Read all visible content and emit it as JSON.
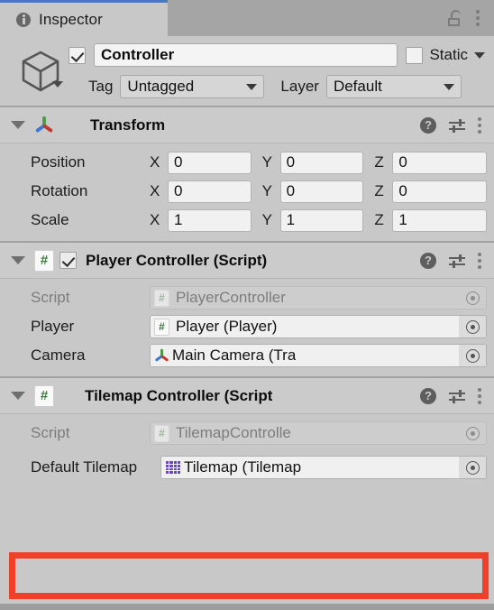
{
  "window": {
    "tab_label": "Inspector",
    "tab_icon": "info-icon",
    "lock_icon": "lock-open-icon",
    "menu_icon": "kebab-menu-icon",
    "accent_color": "#4a79c4",
    "background_color": "#c8c8c8",
    "highlight_color": "#f0402a"
  },
  "game_object": {
    "icon": "cube-icon",
    "enabled": true,
    "name": "Controller",
    "static_label": "Static",
    "static_checked": false,
    "tag_label": "Tag",
    "tag_value": "Untagged",
    "layer_label": "Layer",
    "layer_value": "Default"
  },
  "components": [
    {
      "id": "transform",
      "title": "Transform",
      "icon": "transform-gizmo-icon",
      "has_enable_checkbox": false,
      "expanded": true,
      "help_icon": "help-icon",
      "preset_icon": "preset-settings-icon",
      "menu_icon": "kebab-menu-icon",
      "rows": [
        {
          "label": "Position",
          "x": "0",
          "y": "0",
          "z": "0"
        },
        {
          "label": "Rotation",
          "x": "0",
          "y": "0",
          "z": "0"
        },
        {
          "label": "Scale",
          "x": "1",
          "y": "1",
          "z": "1"
        }
      ],
      "axis_labels": {
        "x": "X",
        "y": "Y",
        "z": "Z"
      }
    },
    {
      "id": "player-controller",
      "title": "Player Controller (Script)",
      "icon": "cs-script-icon",
      "has_enable_checkbox": true,
      "enabled": true,
      "expanded": true,
      "help_icon": "help-icon",
      "preset_icon": "preset-settings-icon",
      "menu_icon": "kebab-menu-icon",
      "fields": [
        {
          "label": "Script",
          "value": "PlayerController",
          "icon": "cs-script-icon",
          "disabled": true
        },
        {
          "label": "Player",
          "value": "Player (Player)",
          "icon": "cs-script-icon",
          "disabled": false
        },
        {
          "label": "Camera",
          "value": "Main Camera (Tra",
          "icon": "transform-gizmo-icon",
          "disabled": false
        }
      ]
    },
    {
      "id": "tilemap-controller",
      "title": "Tilemap Controller (Script",
      "icon": "cs-script-icon",
      "has_enable_checkbox": false,
      "expanded": true,
      "help_icon": "help-icon",
      "preset_icon": "preset-settings-icon",
      "menu_icon": "kebab-menu-icon",
      "fields": [
        {
          "label": "Script",
          "value": "TilemapControlle",
          "icon": "cs-script-icon",
          "disabled": true
        },
        {
          "label": "Default Tilemap",
          "value": "Tilemap (Tilemap",
          "icon": "tilemap-grid-icon",
          "disabled": false,
          "highlighted": true
        }
      ]
    }
  ]
}
